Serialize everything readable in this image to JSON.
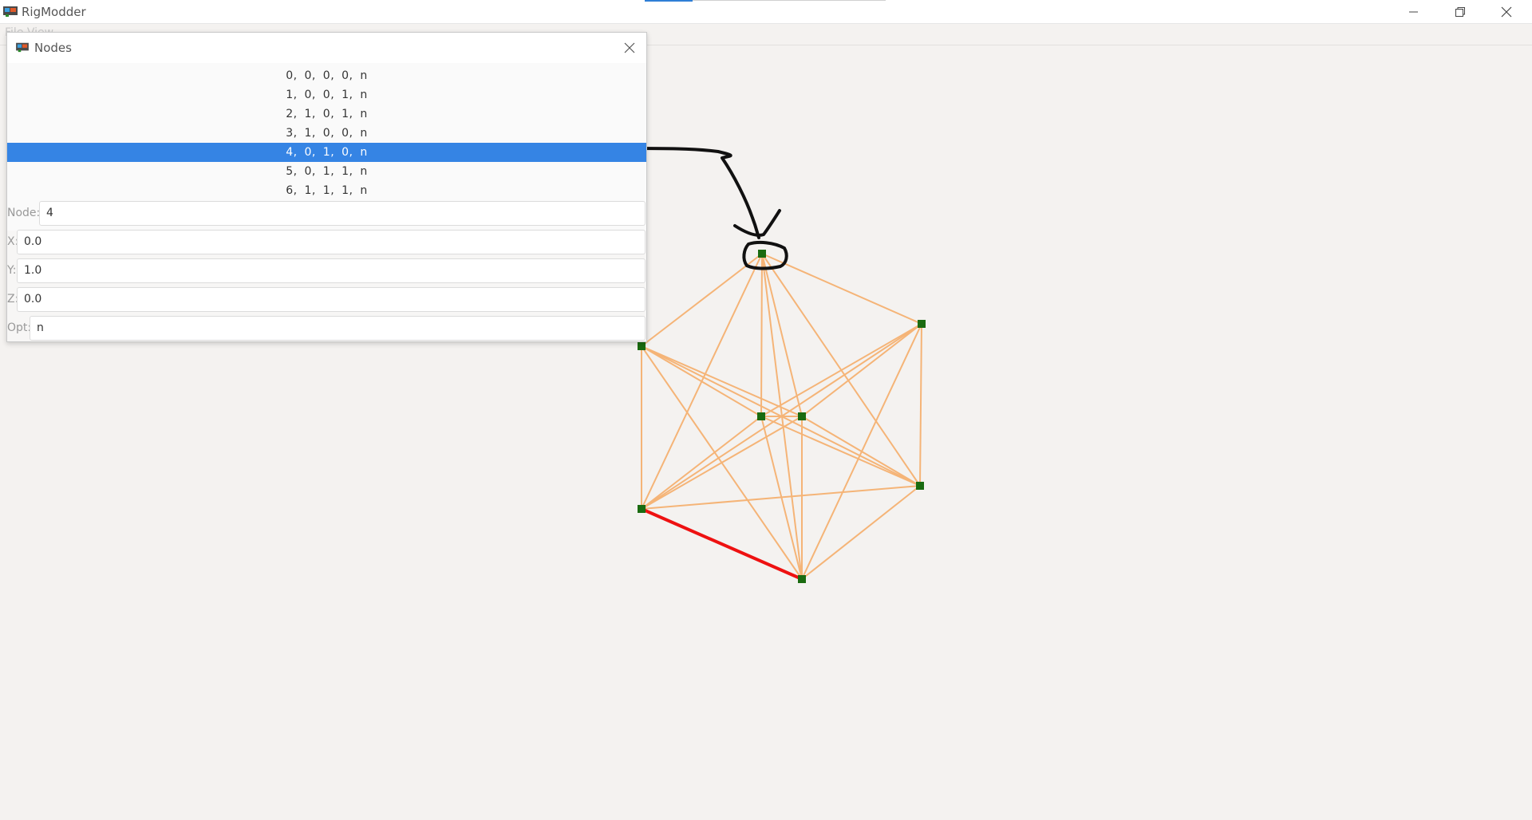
{
  "window": {
    "title": "RigModder",
    "menubar_text": "File   View"
  },
  "dialog": {
    "title": "Nodes",
    "nodes": [
      "0,  0,  0,  0,  n",
      "1,  0,  0,  1,  n",
      "2,  1,  0,  1,  n",
      "3,  1,  0,  0,  n",
      "4,  0,  1,  0,  n",
      "5,  0,  1,  1,  n",
      "6,  1,  1,  1,  n"
    ],
    "selected_index": 4,
    "fields": {
      "node_label": "Node:",
      "node_value": "4",
      "x_label": "X:",
      "x_value": "0.0",
      "y_label": "Y:",
      "y_value": "1.0",
      "z_label": "Z:",
      "z_value": "0.0",
      "opt_label": "Opt:",
      "opt_value": "n"
    }
  },
  "colors": {
    "beam": "#f5b477",
    "selected_beam": "#ee1111",
    "node": "#1a6b10",
    "selection_highlight": "#3584e4",
    "annotation": "#111111"
  },
  "icons": [
    "app-icon",
    "minimize-icon",
    "restore-icon",
    "close-icon",
    "dialog-close-icon"
  ]
}
